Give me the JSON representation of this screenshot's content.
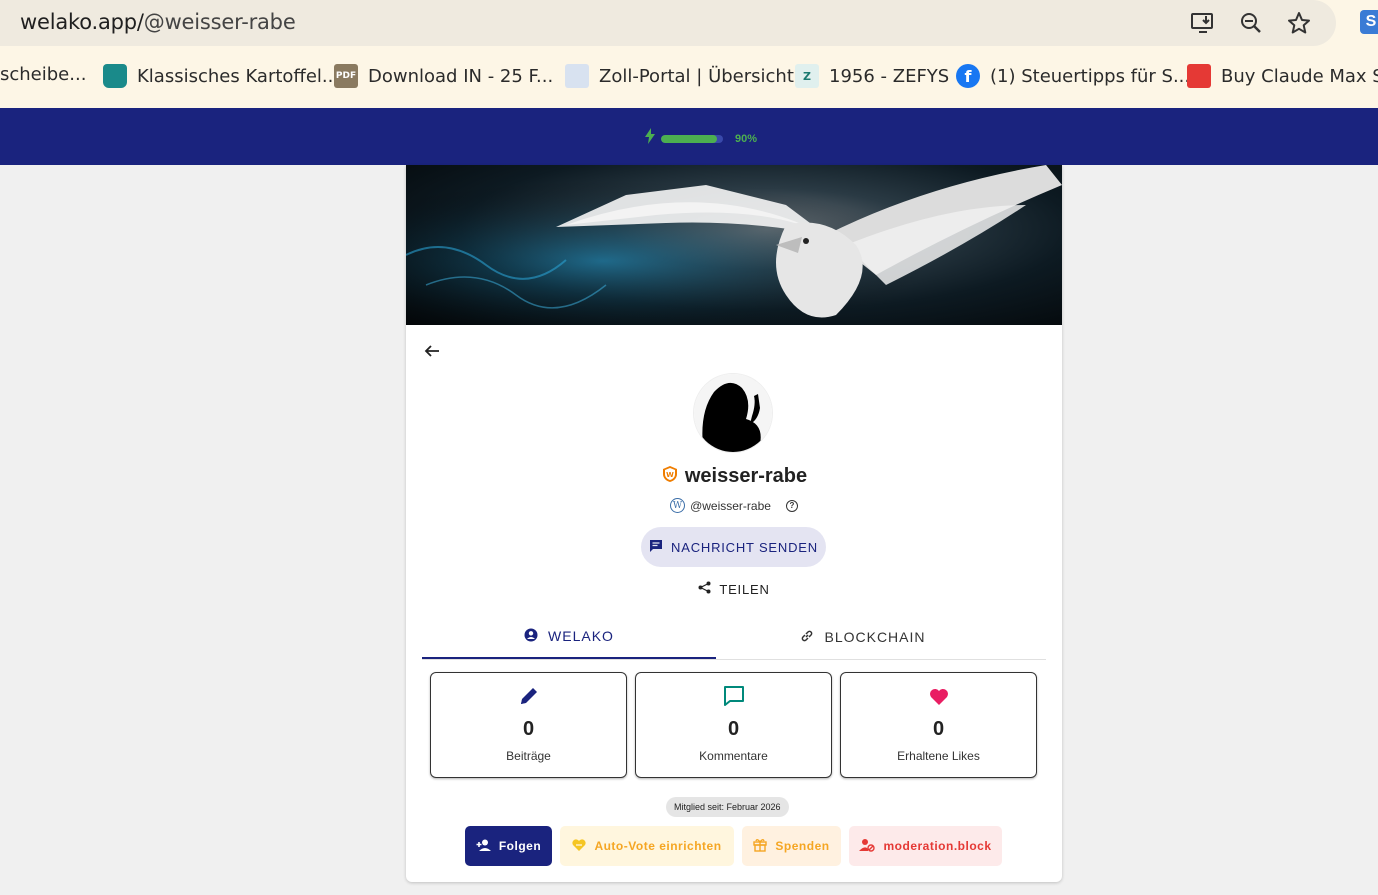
{
  "browser": {
    "url_domain": "welako.app/",
    "url_path": "@weisser-rabe",
    "bookmarks": [
      {
        "label": "scheibe...",
        "icon": "none"
      },
      {
        "label": "Klassisches Kartoffel...",
        "icon": "pot-icon"
      },
      {
        "label": "Download IN - 25 F...",
        "icon": "pdf-icon"
      },
      {
        "label": "Zoll-Portal | Übersicht",
        "icon": "zoll-icon"
      },
      {
        "label": "1956 - ZEFYS",
        "icon": "zefys-icon"
      },
      {
        "label": "(1) Steuertipps für S...",
        "icon": "facebook-icon"
      },
      {
        "label": "Buy Claude Max Su...",
        "icon": "claude-store-icon"
      }
    ],
    "pdf_icon_text": "PDF",
    "zefys_icon_text": "Z",
    "facebook_icon_text": "f",
    "ext_icon_text": "S"
  },
  "header": {
    "progress_label": "90%",
    "progress_value": 0.9
  },
  "profile": {
    "username": "weisser-rabe",
    "handle": "@weisser-rabe",
    "message_button": "NACHRICHT SENDEN",
    "share_button": "TEILEN"
  },
  "tabs": [
    {
      "label": "WELAKO",
      "active": true
    },
    {
      "label": "BLOCKCHAIN",
      "active": false
    }
  ],
  "stats": [
    {
      "value": "0",
      "label": "Beiträge",
      "icon": "pencil-icon",
      "color": "#1a237e"
    },
    {
      "value": "0",
      "label": "Kommentare",
      "icon": "comment-icon",
      "color": "#00897b"
    },
    {
      "value": "0",
      "label": "Erhaltene Likes",
      "icon": "heart-icon",
      "color": "#e91e63"
    }
  ],
  "member_since": "Mitglied seit: Februar 2026",
  "actions": {
    "follow": "Folgen",
    "autovote": "Auto-Vote einrichten",
    "donate": "Spenden",
    "block": "moderation.block"
  },
  "colors": {
    "primary": "#1a237e",
    "progress": "#4caf50",
    "warning": "#f5a623",
    "danger": "#e53935"
  }
}
